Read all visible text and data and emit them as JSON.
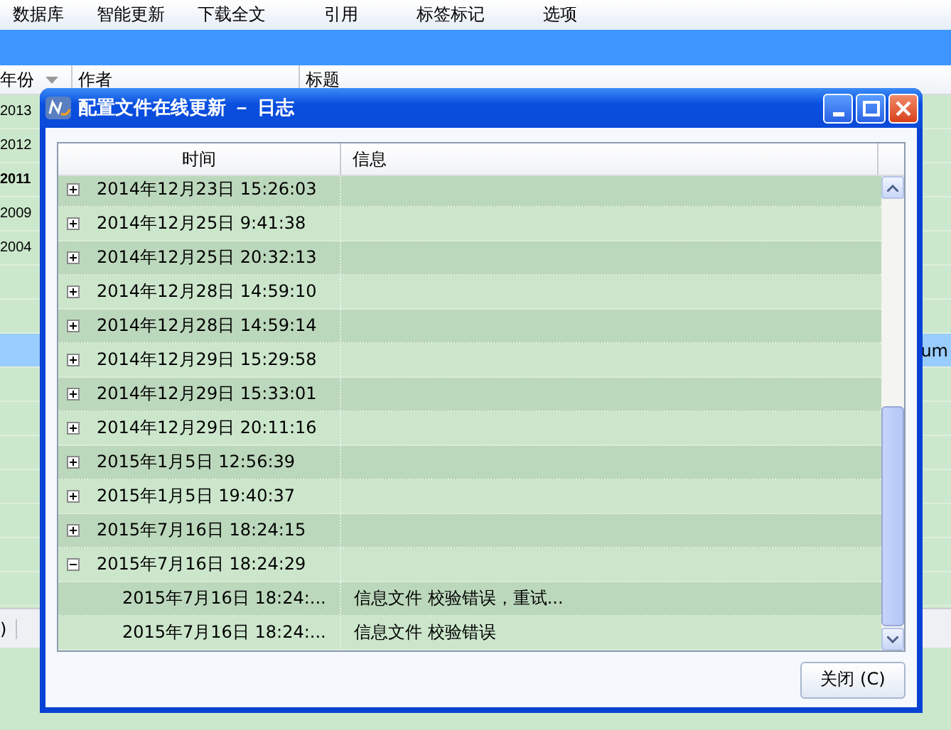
{
  "menu": [
    "数据库",
    "智能更新",
    "下载全文",
    "引用",
    "标签标记",
    "选项"
  ],
  "table": {
    "columns": [
      {
        "label": "年份",
        "sorted": true
      },
      {
        "label": "作者",
        "sorted": false
      },
      {
        "label": "标题",
        "sorted": false
      }
    ],
    "rows": [
      {
        "year": "2013",
        "bold": false,
        "selected": false
      },
      {
        "year": "2012",
        "bold": false,
        "selected": false
      },
      {
        "year": "2011",
        "bold": true,
        "selected": false
      },
      {
        "year": "2009",
        "bold": false,
        "selected": false
      },
      {
        "year": "2004",
        "bold": false,
        "selected": false
      },
      {
        "selected": false
      },
      {
        "selected": false
      },
      {
        "title": "um",
        "selected": true
      },
      {
        "selected": false
      },
      {
        "selected": false
      },
      {
        "selected": false
      },
      {
        "selected": false
      },
      {
        "selected": false
      },
      {
        "selected": false
      },
      {
        "selected": false
      }
    ]
  },
  "status_bar": {
    "text": ")"
  },
  "dialog": {
    "title": "配置文件在线更新 － 日志",
    "columns": [
      "时间",
      "信息"
    ],
    "log": [
      {
        "time": "2014年12月23日 15:26:03",
        "expanded": false
      },
      {
        "time": "2014年12月25日 9:41:38",
        "expanded": false
      },
      {
        "time": "2014年12月25日 20:32:13",
        "expanded": false
      },
      {
        "time": "2014年12月28日 14:59:10",
        "expanded": false
      },
      {
        "time": "2014年12月28日 14:59:14",
        "expanded": false
      },
      {
        "time": "2014年12月29日 15:29:58",
        "expanded": false
      },
      {
        "time": "2014年12月29日 15:33:01",
        "expanded": false
      },
      {
        "time": "2014年12月29日 20:11:16",
        "expanded": false
      },
      {
        "time": "2015年1月5日 12:56:39",
        "expanded": false
      },
      {
        "time": "2015年1月5日 19:40:37",
        "expanded": false
      },
      {
        "time": "2015年7月16日 18:24:15",
        "expanded": false
      },
      {
        "time": "2015年7月16日 18:24:29",
        "expanded": true,
        "children": [
          {
            "time": "2015年7月16日 18:24:...",
            "message": "信息文件 校验错误，重试..."
          },
          {
            "time": "2015年7月16日 18:24:...",
            "message": "信息文件 校验错误"
          }
        ]
      }
    ],
    "close_button": "关闭 (C)"
  }
}
